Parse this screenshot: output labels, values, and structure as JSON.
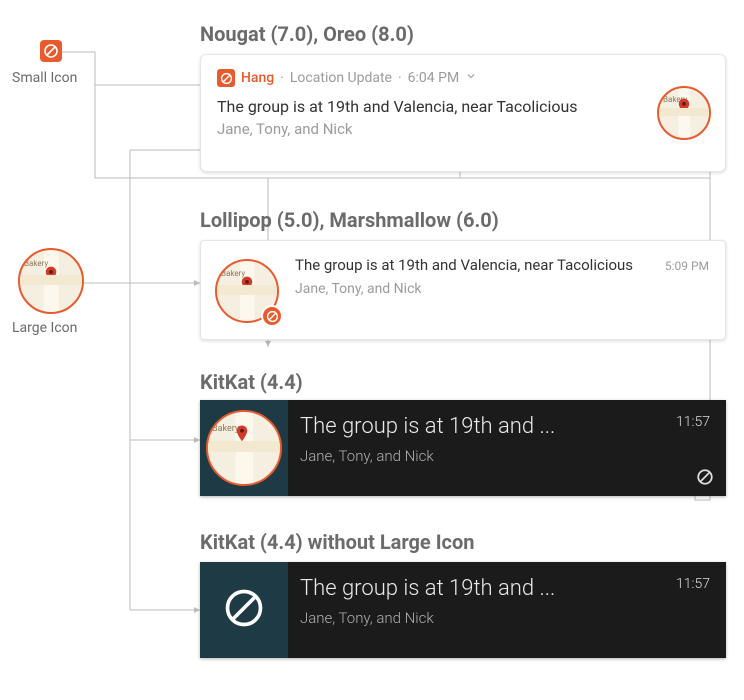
{
  "labels": {
    "small_icon": "Small Icon",
    "large_icon": "Large Icon"
  },
  "sections": {
    "oreo": "Nougat (7.0), Oreo (8.0)",
    "marsh": "Lollipop (5.0), Marshmallow (6.0)",
    "kitkat": "KitKat (4.4)",
    "kitkat_no_large": "KitKat (4.4) without Large Icon"
  },
  "notification": {
    "app_name": "Hang",
    "subtext": "Location Update",
    "title_full": "The group is at 19th and Valencia, near Tacolicious",
    "title_trunc": "The group is at 19th and ...",
    "body": "Jane, Tony, and Nick",
    "large_icon_label": "Bakery"
  },
  "times": {
    "oreo": "6:04 PM",
    "marsh": "5:09 PM",
    "kitkat": "11:57"
  },
  "separators": {
    "dot": "·"
  },
  "icons": {
    "small": "app-circle-slash-icon",
    "chevron": "chevron-down-icon",
    "pin": "map-pin-icon"
  },
  "colors": {
    "accent": "#E95A2D",
    "muted": "#9b9b9b",
    "dark_bg": "#1b1b1b",
    "dark_stripe": "#1d3a45"
  }
}
